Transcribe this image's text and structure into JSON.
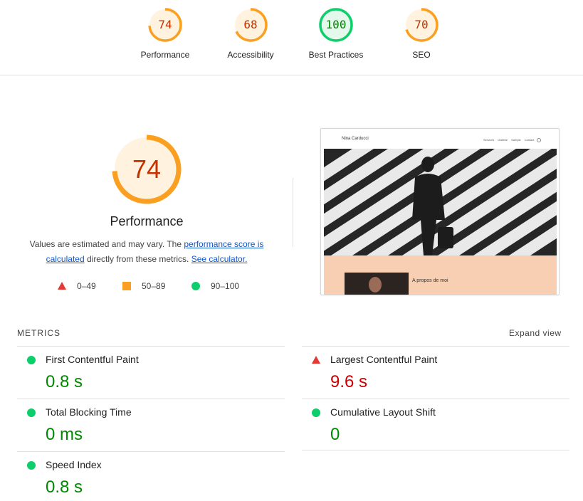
{
  "top_scores": [
    {
      "score": "74",
      "label": "Performance",
      "rating": "average",
      "fraction": 0.74
    },
    {
      "score": "68",
      "label": "Accessibility",
      "rating": "average",
      "fraction": 0.68
    },
    {
      "score": "100",
      "label": "Best Practices",
      "rating": "pass",
      "fraction": 1.0
    },
    {
      "score": "70",
      "label": "SEO",
      "rating": "average",
      "fraction": 0.7
    }
  ],
  "performance": {
    "score": "74",
    "fraction": 0.74,
    "title": "Performance",
    "desc_part1": "Values are estimated and may vary. The ",
    "desc_link1": "performance score is calculated",
    "desc_part2": " directly from these metrics. ",
    "desc_link2": "See calculator."
  },
  "legend": [
    {
      "range": "0–49",
      "shape": "triangle",
      "color": "#e53935"
    },
    {
      "range": "50–89",
      "shape": "square",
      "color": "#fa9f1f"
    },
    {
      "range": "90–100",
      "shape": "circle",
      "color": "#0cce6b"
    }
  ],
  "thumbnail": {
    "brand": "Nina Carducci",
    "nav_links": [
      "Services",
      "Gallerie",
      "Sample",
      "Contact"
    ],
    "section_title": "A propos de moi"
  },
  "metrics": {
    "header": "METRICS",
    "expand_label": "Expand view",
    "items": [
      {
        "name": "First Contentful Paint",
        "value": "0.8 s",
        "status": "good"
      },
      {
        "name": "Largest Contentful Paint",
        "value": "9.6 s",
        "status": "bad"
      },
      {
        "name": "Total Blocking Time",
        "value": "0 ms",
        "status": "good"
      },
      {
        "name": "Cumulative Layout Shift",
        "value": "0",
        "status": "good"
      },
      {
        "name": "Speed Index",
        "value": "0.8 s",
        "status": "good"
      }
    ]
  },
  "colors": {
    "average_fg": "#c33300",
    "average_ring": "#fa9f1f",
    "average_bg": "#fff3e0",
    "pass_fg": "#008800",
    "pass_ring": "#0cce6b",
    "pass_bg": "#e5f8ec",
    "fail": "#e53935",
    "link": "#1155cc"
  }
}
